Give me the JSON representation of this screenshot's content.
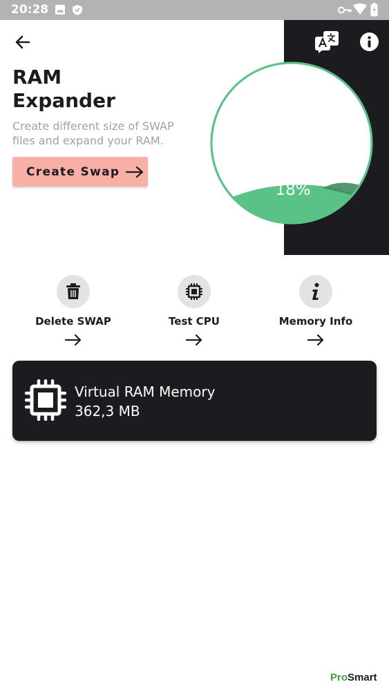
{
  "status_bar": {
    "time": "20:28",
    "icons": [
      "gallery-icon",
      "shield-icon",
      "vpn-key-icon",
      "wifi-icon",
      "battery-icon"
    ]
  },
  "toolbar": {
    "back_icon": "arrow-back-icon",
    "translate_icon": "translate-icon",
    "info_icon": "info-icon"
  },
  "header": {
    "title_line1": "RAM",
    "title_line2": "Expander",
    "subtitle": "Create different size of SWAP files and expand your RAM.",
    "create_button_label": "Create Swap"
  },
  "gauge": {
    "percent_label": "18%",
    "percent": 18,
    "color": "#5ac287"
  },
  "actions": [
    {
      "label": "Delete SWAP",
      "icon": "trash-icon"
    },
    {
      "label": "Test CPU",
      "icon": "cpu-icon"
    },
    {
      "label": "Memory Info",
      "icon": "info-icon"
    }
  ],
  "memory_card": {
    "title": "Virtual RAM Memory",
    "value": "362,3 MB",
    "icon": "chip-icon"
  },
  "watermark": {
    "part1": "Pro",
    "part2": "Smart"
  },
  "colors": {
    "dark": "#1c1b1f",
    "accent_button": "#f8b0a6",
    "gauge_green": "#5ac287",
    "status_bar": "#b3b3b3"
  }
}
